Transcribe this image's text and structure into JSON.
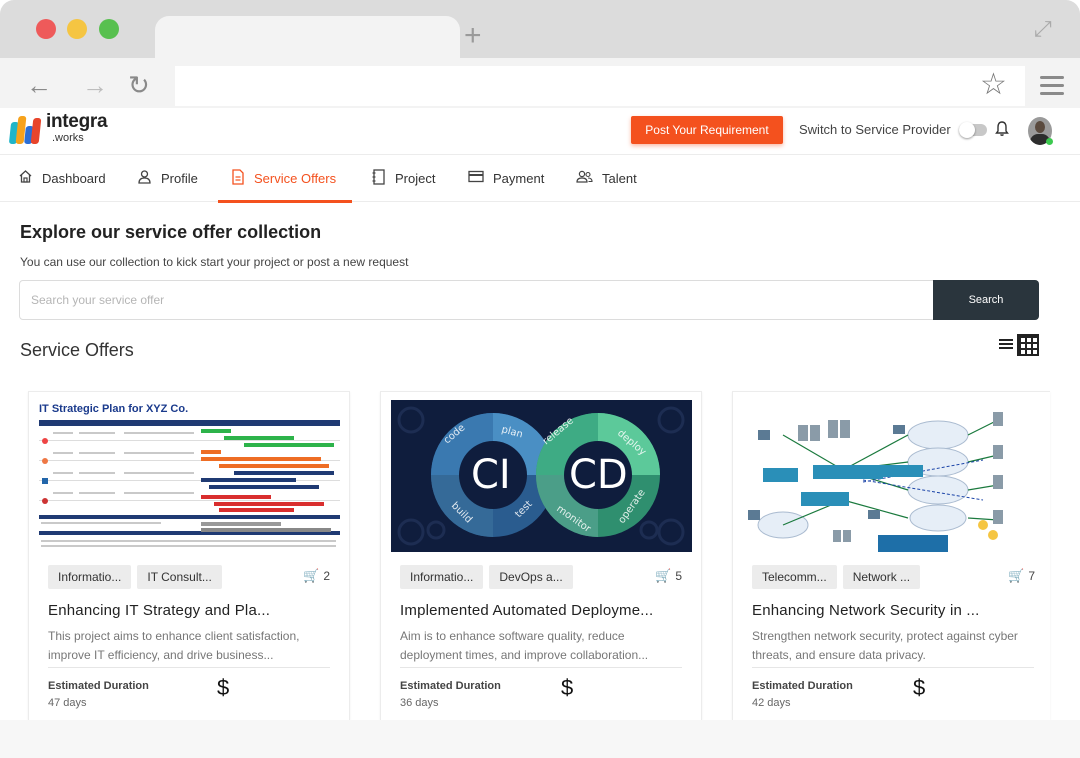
{
  "browser": {
    "tab_plus": "+",
    "back": "←",
    "forward": "→",
    "reload": "↻",
    "star": "☆"
  },
  "header": {
    "logo_main": "integra",
    "logo_sub": ".works",
    "post_button": "Post Your Requirement",
    "switch_label": "Switch to Service Provider"
  },
  "nav": {
    "items": [
      {
        "label": "Dashboard",
        "icon": "home-icon"
      },
      {
        "label": "Profile",
        "icon": "user-icon"
      },
      {
        "label": "Service Offers",
        "icon": "document-icon",
        "active": true
      },
      {
        "label": "Project",
        "icon": "notebook-icon"
      },
      {
        "label": "Payment",
        "icon": "card-icon"
      },
      {
        "label": "Talent",
        "icon": "people-icon"
      }
    ]
  },
  "main": {
    "title": "Explore our service offer collection",
    "subtitle": "You can use our collection to kick start your project or post a new request",
    "search_placeholder": "Search your service offer",
    "search_button": "Search",
    "section_title": "Service Offers"
  },
  "cards": [
    {
      "tags": [
        "Informatio...",
        "IT Consult..."
      ],
      "cart_count": "2",
      "title": "Enhancing IT Strategy and Pla...",
      "description": "This project aims to enhance client satisfaction, improve IT efficiency, and drive business...",
      "est_label": "Estimated Duration",
      "est_value": "47 days",
      "price_symbol": "$",
      "image_title": "IT Strategic Plan for XYZ Co."
    },
    {
      "tags": [
        "Informatio...",
        "DevOps a..."
      ],
      "cart_count": "5",
      "title": "Implemented Automated Deployme...",
      "description": "Aim is to enhance software quality, reduce deployment times, and improve collaboration...",
      "est_label": "Estimated Duration",
      "est_value": "36 days",
      "price_symbol": "$",
      "image_ci": "CI",
      "image_cd": "CD"
    },
    {
      "tags": [
        "Telecomm...",
        "Network ..."
      ],
      "cart_count": "7",
      "title": "Enhancing Network Security in ...",
      "description": "Strengthen network security, protect against cyber threats, and ensure data privacy.",
      "est_label": "Estimated Duration",
      "est_value": "42 days",
      "price_symbol": "$"
    }
  ],
  "colors": {
    "accent": "#f4511e",
    "dark_button": "#2a353d"
  }
}
